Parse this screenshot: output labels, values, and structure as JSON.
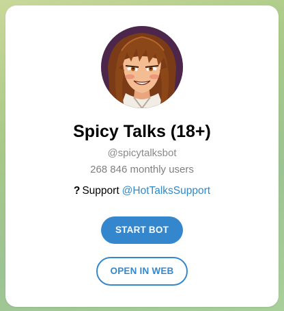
{
  "background": {
    "accent_colors": [
      "#c9d89a",
      "#a8c987",
      "#9cc393"
    ]
  },
  "bot": {
    "avatar_icon": "anime-girl-avatar",
    "title": "Spicy Talks (18+)",
    "username": "@spicytalksbot",
    "monthly_users": "268 846 monthly users",
    "support": {
      "icon": "question-mark-icon",
      "glyph": "?",
      "label": "Support",
      "link": "@HotTalksSupport"
    }
  },
  "actions": {
    "start_label": "START BOT",
    "web_label": "OPEN IN WEB"
  },
  "colors": {
    "accent": "#3487cc",
    "link": "#2f88c8",
    "muted": "#8a8a8a"
  }
}
